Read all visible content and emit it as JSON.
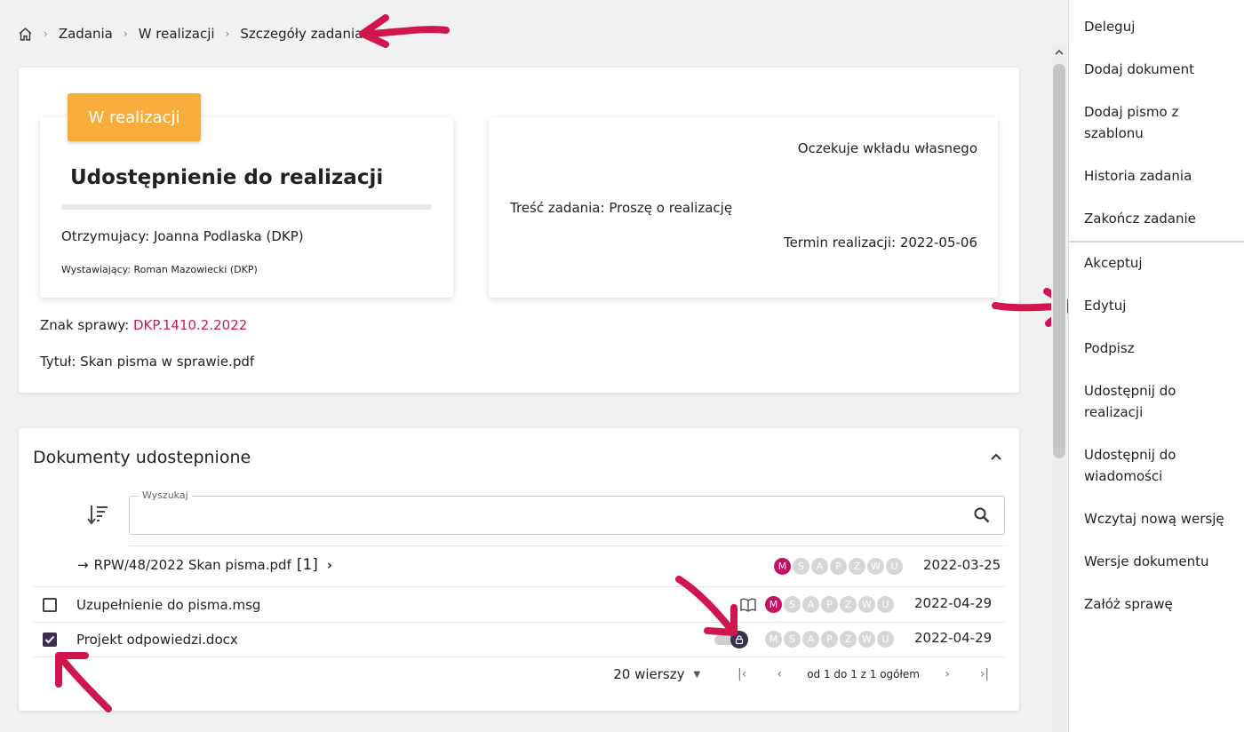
{
  "breadcrumb": {
    "home_icon": "home-icon",
    "items": [
      "Zadania",
      "W realizacji",
      "Szczegóły zadania"
    ]
  },
  "task": {
    "status": "W realizacji",
    "status_color": "#f7ac3b",
    "title": "Udostępnienie do realizacji",
    "recipient": "Otrzymujacy: Joanna Podlaska (DKP)",
    "issuer": "Wystawiający: Roman Mazowiecki (DKP)",
    "awaiting": "Oczekuje wkładu własnego",
    "content": "Treść zadania: Proszę o realizację",
    "deadline": "Termin realizacji: 2022-05-06",
    "case_sign_label": "Znak sprawy: ",
    "case_sign_value": "DKP.1410.2.2022",
    "doc_title": "Tytuł: Skan pisma w sprawie.pdf"
  },
  "documents": {
    "header": "Dokumenty udostepnione",
    "search_label": "Wyszukaj",
    "group": {
      "arrow": "→",
      "label": "RPW/48/2022 Skan pisma.pdf",
      "count": "[1]",
      "chevron": "›",
      "statuses": [
        "M",
        "S",
        "A",
        "P",
        "Z",
        "W",
        "U"
      ],
      "active_status": "M",
      "date": "2022-03-25"
    },
    "rows": [
      {
        "name": "Uzupełnienie do pisma.msg",
        "checked": false,
        "statuses": [
          "M",
          "S",
          "A",
          "P",
          "Z",
          "W",
          "U"
        ],
        "active_status": "M",
        "date": "2022-04-29"
      },
      {
        "name": "Projekt odpowiedzi.docx",
        "checked": true,
        "statuses": [
          "M",
          "S",
          "A",
          "P",
          "Z",
          "W",
          "U"
        ],
        "active_status": "",
        "date": "2022-04-29"
      }
    ],
    "pager": {
      "rows_per_page": "20 wierszy",
      "range": "od 1 do 1 z 1 ogółem"
    }
  },
  "side_menu": {
    "group1": [
      "Deleguj",
      "Dodaj dokument",
      "Dodaj pismo z szablonu",
      "Historia zadania",
      "Zakończ zadanie"
    ],
    "group2": [
      "Akceptuj",
      "Edytuj",
      "Podpisz",
      "Udostępnij do realizacji",
      "Udostępnij do wiadomości",
      "Wczytaj nową wersję",
      "Wersje dokumentu",
      "Załóż sprawę"
    ]
  },
  "colors": {
    "accent_link": "#d1174f",
    "status_active": "#c41262",
    "annotation_arrow": "#d0164c",
    "dark_primary": "#3c2f54"
  }
}
